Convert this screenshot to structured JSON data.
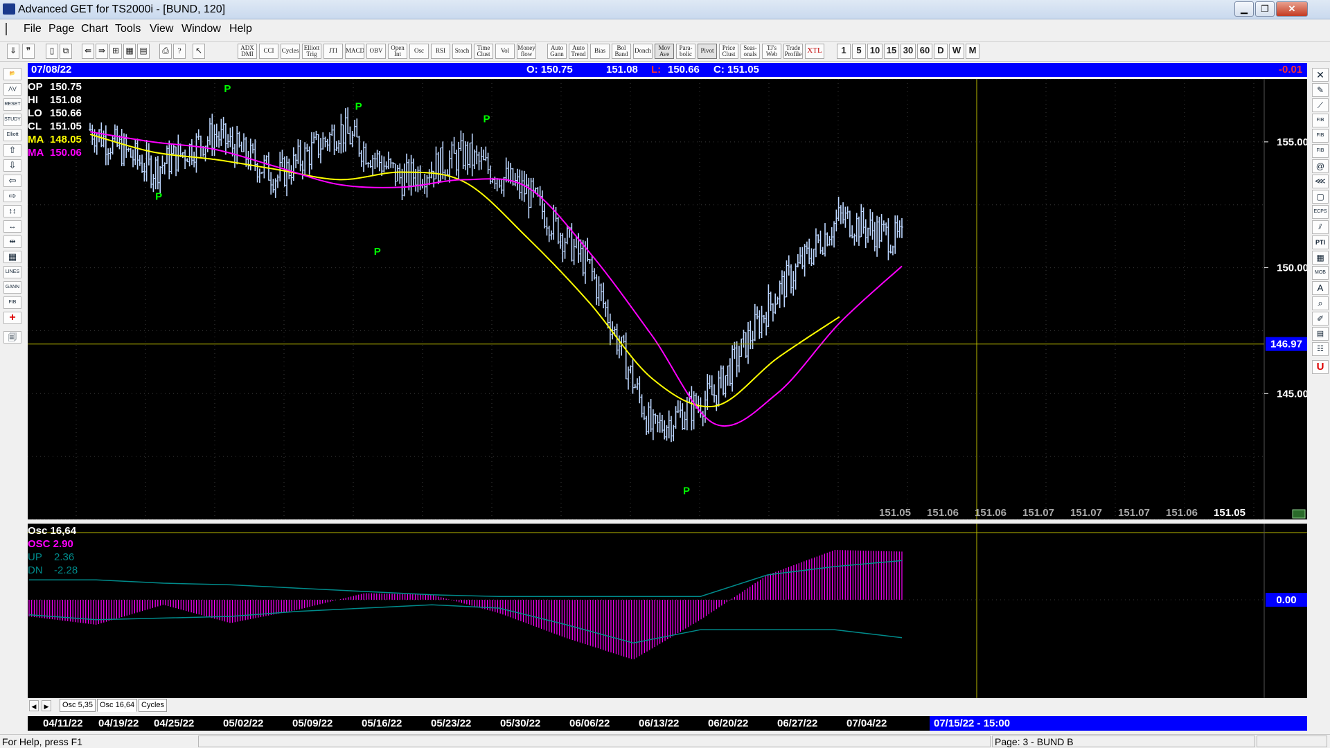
{
  "window": {
    "title": "Advanced GET for TS2000i - [BUND, 120]"
  },
  "menu": [
    "File",
    "Page",
    "Chart",
    "Tools",
    "View",
    "Window",
    "Help"
  ],
  "toolbar": {
    "studies": [
      "ADX DMI",
      "CCI",
      "Cycles",
      "Elliott Trig",
      "JTI",
      "MACD",
      "OBV",
      "Open Int",
      "Osc",
      "RSI",
      "Stoch",
      "Time Clust",
      "Vol",
      "Money flow"
    ],
    "studies2": [
      "Auto Gann",
      "Auto Trend",
      "Bias",
      "Bol Band",
      "Donch",
      "Mov Ave",
      "Para- bolic",
      "Pivot",
      "Price Clust",
      "Seas- onals",
      "TJ's Web",
      "Trade Profile",
      "XTL"
    ],
    "intervals": [
      "1",
      "5",
      "10",
      "15",
      "30",
      "60",
      "D",
      "W",
      "M"
    ]
  },
  "left_tools": [
    "RESET",
    "STUDY",
    "Elliott",
    "LINES",
    "GANN",
    "FIB"
  ],
  "right_tools": [
    "FIB RET",
    "FIB EXT",
    "FIB TIME",
    "ECPS",
    "PTI",
    "MOB"
  ],
  "info_bar": {
    "date": "07/08/22",
    "open": "O: 150.75",
    "high": "151.08",
    "low_label": "L:",
    "low": "150.66",
    "close": "C: 151.05",
    "change": "-0.01"
  },
  "price_legend": [
    {
      "label": "OP",
      "value": "150.75",
      "color": "#ffffff"
    },
    {
      "label": "HI",
      "value": "151.08",
      "color": "#ffffff"
    },
    {
      "label": "LO",
      "value": "150.66",
      "color": "#ffffff"
    },
    {
      "label": "CL",
      "value": "151.05",
      "color": "#ffffff"
    },
    {
      "label": "MA",
      "value": "148.05",
      "color": "#ffff00"
    },
    {
      "label": "MA",
      "value": "150.06",
      "color": "#ff00ff"
    }
  ],
  "price_axis": [
    "155.00",
    "150.00",
    "145.00"
  ],
  "crosshair_price": "146.97",
  "pivot_marker": "P",
  "projection_values": [
    "151.05",
    "151.06",
    "151.06",
    "151.07",
    "151.07",
    "151.07",
    "151.06",
    "151.05"
  ],
  "osc_legend": {
    "title": "Osc 16,64",
    "osc": "OSC 2.90",
    "up_label": "UP",
    "up_value": "2.36",
    "dn_label": "DN",
    "dn_value": "-2.28"
  },
  "osc_axis": "0.00",
  "tabs": [
    "Osc 5,35",
    "Osc 16,64",
    "Cycles"
  ],
  "dates": [
    "04/11/22",
    "04/19/22",
    "04/25/22",
    "05/02/22",
    "05/09/22",
    "05/16/22",
    "05/23/22",
    "05/30/22",
    "06/06/22",
    "06/13/22",
    "06/20/22",
    "06/27/22",
    "07/04/22"
  ],
  "cursor_date": "07/15/22 - 15:00",
  "status": {
    "help": "For Help, press F1",
    "page": "Page: 3 - BUND B"
  },
  "colors": {
    "ma_fast": "#ffff00",
    "ma_slow": "#ff00ff",
    "bars": "#bcd6ff",
    "pivot": "#00ff00",
    "osc": "#ff00ff",
    "up_dn": "#008b8b",
    "crosshair": "#b8b800"
  },
  "chart_data": {
    "type": "ohlc",
    "title": "BUND, 120",
    "x": [
      "04/11/22",
      "04/19/22",
      "04/25/22",
      "05/02/22",
      "05/09/22",
      "05/16/22",
      "05/23/22",
      "05/30/22",
      "06/06/22",
      "06/13/22",
      "06/20/22",
      "06/27/22",
      "07/04/22",
      "07/08/22"
    ],
    "series": [
      {
        "name": "Close",
        "values": [
          155.5,
          153.9,
          155.3,
          153.6,
          155.5,
          153.5,
          154.5,
          153.0,
          150.0,
          143.5,
          145.0,
          149.0,
          152.0,
          151.05
        ]
      },
      {
        "name": "MA",
        "values": [
          155.3,
          154.6,
          154.3,
          153.9,
          153.5,
          153.8,
          153.4,
          151.2,
          148.6,
          145.6,
          144.5,
          146.4,
          148.05,
          148.05
        ]
      },
      {
        "name": "MA",
        "values": [
          155.4,
          155.0,
          154.7,
          154.0,
          153.3,
          153.2,
          153.5,
          153.2,
          150.6,
          147.3,
          143.8,
          145.0,
          147.8,
          150.06
        ]
      }
    ],
    "pivots": [
      {
        "label": "P",
        "x": "04/19/22",
        "price": 153.2,
        "type": "low"
      },
      {
        "label": "P",
        "x": "04/25/22",
        "price": 156.7,
        "type": "high"
      },
      {
        "label": "P",
        "x": "05/09/22",
        "price": 151.0,
        "type": "low"
      },
      {
        "label": "P",
        "x": "05/09/22",
        "price": 156.0,
        "type": "high"
      },
      {
        "label": "P",
        "x": "05/23/22",
        "price": 155.5,
        "type": "high"
      },
      {
        "label": "P",
        "x": "06/13/22",
        "price": 141.5,
        "type": "low"
      }
    ],
    "ylim": [
      140.0,
      157.5
    ],
    "crosshair": {
      "price": 146.97,
      "date": "07/15/22 - 15:00"
    },
    "oscillator": {
      "name": "Osc 16,64",
      "x": [
        "04/11/22",
        "04/19/22",
        "04/25/22",
        "05/02/22",
        "05/09/22",
        "05/16/22",
        "05/23/22",
        "05/30/22",
        "06/06/22",
        "06/13/22",
        "06/20/22",
        "06/27/22",
        "07/04/22",
        "07/08/22"
      ],
      "values": [
        -1.0,
        -1.5,
        -0.3,
        -1.4,
        -0.6,
        0.4,
        0.3,
        -0.8,
        -2.3,
        -3.6,
        -1.2,
        1.5,
        3.0,
        2.9
      ],
      "up": [
        1.2,
        1.2,
        1.0,
        0.9,
        0.7,
        0.5,
        0.3,
        0.2,
        0.2,
        0.2,
        0.2,
        1.5,
        2.0,
        2.36
      ],
      "dn": [
        -0.9,
        -1.2,
        -1.1,
        -1.0,
        -0.7,
        -0.5,
        -0.3,
        -0.5,
        -1.5,
        -2.6,
        -1.8,
        -1.8,
        -1.8,
        -2.28
      ]
    }
  }
}
